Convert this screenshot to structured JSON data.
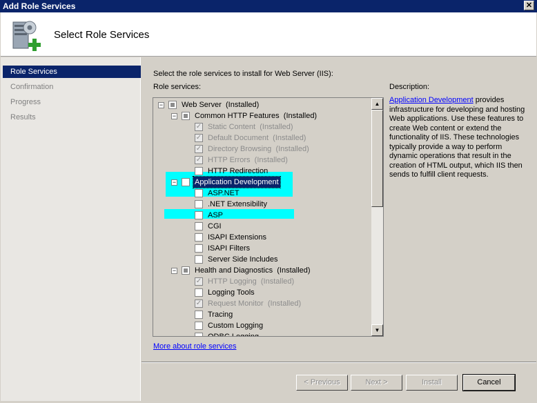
{
  "window": {
    "title": "Add Role Services",
    "close_glyph": "✕"
  },
  "header": {
    "heading": "Select Role Services",
    "icon": "server-add-icon"
  },
  "sidebar": {
    "items": [
      {
        "label": "Role Services",
        "active": true
      },
      {
        "label": "Confirmation",
        "active": false
      },
      {
        "label": "Progress",
        "active": false
      },
      {
        "label": "Results",
        "active": false
      }
    ]
  },
  "main": {
    "instruction": "Select the role services to install for Web Server (IIS):",
    "services_label": "Role services:",
    "description_label": "Description:",
    "more_link": "More about role services",
    "tree": [
      {
        "label": "Web Server",
        "status": "(Installed)",
        "state": "partial",
        "expander": "−",
        "level": 0,
        "highlight": false
      },
      {
        "label": "Common HTTP Features",
        "status": "(Installed)",
        "state": "partial",
        "expander": "−",
        "level": 1,
        "highlight": false
      },
      {
        "label": "Static Content",
        "status": "(Installed)",
        "state": "installed",
        "level": 2,
        "highlight": false
      },
      {
        "label": "Default Document",
        "status": "(Installed)",
        "state": "installed",
        "level": 2,
        "highlight": false
      },
      {
        "label": "Directory Browsing",
        "status": "(Installed)",
        "state": "installed",
        "level": 2,
        "highlight": false
      },
      {
        "label": "HTTP Errors",
        "status": "(Installed)",
        "state": "installed",
        "level": 2,
        "highlight": false
      },
      {
        "label": "HTTP Redirection",
        "status": "",
        "state": "unchecked",
        "level": 2,
        "highlight": false
      },
      {
        "label": "Application Development",
        "status": "",
        "state": "unchecked",
        "expander": "−",
        "level": 1,
        "highlight": true,
        "selected": true
      },
      {
        "label": "ASP.NET",
        "status": "",
        "state": "unchecked",
        "level": 2,
        "highlight": true
      },
      {
        "label": ".NET Extensibility",
        "status": "",
        "state": "unchecked",
        "level": 2,
        "highlight": false
      },
      {
        "label": "ASP",
        "status": "",
        "state": "unchecked",
        "level": 2,
        "highlight": true
      },
      {
        "label": "CGI",
        "status": "",
        "state": "unchecked",
        "level": 2,
        "highlight": false
      },
      {
        "label": "ISAPI Extensions",
        "status": "",
        "state": "unchecked",
        "level": 2,
        "highlight": false
      },
      {
        "label": "ISAPI Filters",
        "status": "",
        "state": "unchecked",
        "level": 2,
        "highlight": false
      },
      {
        "label": "Server Side Includes",
        "status": "",
        "state": "unchecked",
        "level": 2,
        "highlight": false
      },
      {
        "label": "Health and Diagnostics",
        "status": "(Installed)",
        "state": "partial",
        "expander": "−",
        "level": 1,
        "highlight": false
      },
      {
        "label": "HTTP Logging",
        "status": "(Installed)",
        "state": "installed",
        "level": 2,
        "highlight": false
      },
      {
        "label": "Logging Tools",
        "status": "",
        "state": "unchecked",
        "level": 2,
        "highlight": false
      },
      {
        "label": "Request Monitor",
        "status": "(Installed)",
        "state": "installed",
        "level": 2,
        "highlight": false
      },
      {
        "label": "Tracing",
        "status": "",
        "state": "unchecked",
        "level": 2,
        "highlight": false
      },
      {
        "label": "Custom Logging",
        "status": "",
        "state": "unchecked",
        "level": 2,
        "highlight": false
      },
      {
        "label": "ODBC Logging",
        "status": "",
        "state": "unchecked",
        "level": 2,
        "highlight": false
      }
    ],
    "description": {
      "link_text": "Application Development",
      "text": " provides infrastructure for developing and hosting Web applications. Use these features to create Web content or extend the functionality of IIS. These technologies typically provide a way to perform dynamic operations that result in the creation of HTML output, which IIS then sends to fulfill client requests."
    }
  },
  "buttons": {
    "previous": "< Previous",
    "next": "Next >",
    "install": "Install",
    "cancel": "Cancel"
  },
  "colors": {
    "highlight": "#00ffff",
    "selection": "#0a246a",
    "link": "#0000ff"
  }
}
